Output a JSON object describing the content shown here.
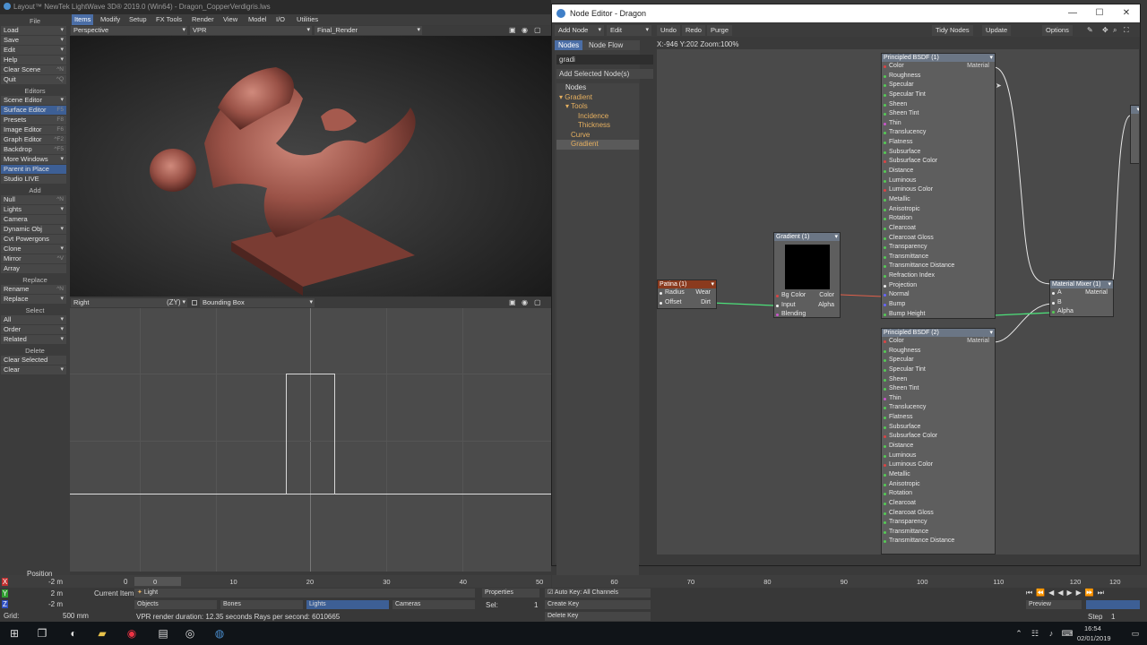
{
  "app": {
    "title": "Layout™ NewTek LightWave 3D® 2019.0 (Win64) - Dragon_CopperVerdigris.lws"
  },
  "left_panel": {
    "file": "File",
    "load": "Load",
    "save": "Save",
    "edit": "Edit",
    "help": "Help",
    "clear_scene": "Clear Scene",
    "clear_scene_key": "^N",
    "quit": "Quit",
    "quit_key": "^Q",
    "editors": "Editors",
    "scene_editor": "Scene Editor",
    "surface_editor": "Surface Editor",
    "surface_editor_key": "F5",
    "presets": "Presets",
    "presets_key": "F8",
    "image_editor": "Image Editor",
    "image_editor_key": "F6",
    "graph_editor": "Graph Editor",
    "graph_editor_key": "^F2",
    "backdrop": "Backdrop",
    "backdrop_key": "^F5",
    "more_windows": "More Windows",
    "parent_in_place": "Parent in Place",
    "studio_live": "Studio LIVE",
    "add": "Add",
    "null": "Null",
    "null_key": "^N",
    "lights": "Lights",
    "camera": "Camera",
    "dynamic_obj": "Dynamic Obj",
    "cvt_powergons": "Cvt Powergons",
    "clone": "Clone",
    "mirror": "Mirror",
    "mirror_key": "^V",
    "array": "Array",
    "replace": "Replace",
    "rename": "Rename",
    "rename_key": "^N",
    "replace_btn": "Replace",
    "select": "Select",
    "all": "All",
    "order": "Order",
    "related": "Related",
    "delete": "Delete",
    "clear_selected": "Clear Selected",
    "clear": "Clear"
  },
  "menu_tabs": [
    "Items",
    "Modify",
    "Setup",
    "FX Tools",
    "Render",
    "View",
    "Model",
    "I/O",
    "Utilities"
  ],
  "viewport_top": {
    "view": "Perspective",
    "mode": "VPR",
    "camera": "Final_Render"
  },
  "viewport_bottom": {
    "view": "Right",
    "axis": "(ZY)",
    "bbox": "Bounding Box"
  },
  "node_editor": {
    "title": "Node Editor - Dragon",
    "toolbar": {
      "add_node": "Add Node",
      "edit": "Edit",
      "undo": "Undo",
      "redo": "Redo",
      "purge": "Purge",
      "tidy": "Tidy Nodes",
      "update": "Update",
      "options": "Options"
    },
    "tabs": {
      "nodes": "Nodes",
      "node_flow": "Node Flow"
    },
    "search": "gradi",
    "add_selected": "Add Selected Node(s)",
    "coords": "X:-946 Y:202 Zoom:100%",
    "tree": [
      "Nodes",
      "Gradient",
      "Tools",
      "Incidence",
      "Thickness",
      "Curve",
      "Gradient"
    ],
    "bsdf1_title": "Principled BSDF (1)",
    "bsdf2_title": "Principled BSDF (2)",
    "material": "Material",
    "bsdf_inputs": [
      "Color",
      "Roughness",
      "Specular",
      "Specular Tint",
      "Sheen",
      "Sheen Tint",
      "Thin",
      "Translucency",
      "Flatness",
      "Subsurface",
      "Subsurface Color",
      "Distance",
      "Luminous",
      "Luminous Color",
      "Metallic",
      "Anisotropic",
      "Rotation",
      "Clearcoat",
      "Clearcoat Gloss",
      "Transparency",
      "Transmittance",
      "Transmittance Distance",
      "Refraction Index",
      "Projection",
      "Normal",
      "Bump",
      "Bump Height"
    ],
    "gradient": {
      "title": "Gradient (1)",
      "inputs": [
        "Bg Color",
        "Input",
        "Blending"
      ],
      "outputs": [
        "Color",
        "Alpha"
      ]
    },
    "patina": {
      "title": "Patina (1)",
      "inputs": [
        "Radius",
        "Offset"
      ],
      "outputs": [
        "Wear",
        "Dirt"
      ]
    },
    "mixer": {
      "title": "Material Mixer (1)",
      "inputs": [
        "A",
        "B",
        "Alpha"
      ],
      "output": "Material"
    }
  },
  "timeline": {
    "ticks": [
      "0",
      "10",
      "20",
      "30",
      "40",
      "50",
      "60",
      "70",
      "80",
      "90",
      "100",
      "110",
      "120"
    ],
    "current": "0",
    "end": "120"
  },
  "bottom": {
    "position": "Position",
    "x": "X",
    "y": "Y",
    "z": "Z",
    "x_val": "-2 m",
    "y_val": "2 m",
    "z_val": "-2 m",
    "grid_label": "Grid:",
    "grid": "500 mm",
    "current_item": "Current Item",
    "item": "Light",
    "objects": "Objects",
    "bones": "Bones",
    "lights": "Lights",
    "cameras": "Cameras",
    "properties": "Properties",
    "sel_label": "Sel:",
    "sel": "1",
    "auto_key": "Auto Key: All Channels",
    "create_key": "Create Key",
    "delete_key": "Delete Key",
    "status": "VPR render duration: 12.35 seconds  Rays per second: 6010665",
    "preview": "Preview",
    "step_label": "Step",
    "step": "1"
  },
  "taskbar": {
    "time": "16:54",
    "date": "02/01/2019"
  },
  "colors": {
    "accent": "#4b6ea6",
    "wire_green": "#4de07a",
    "wire_red": "#e0604a",
    "wire_white": "#e8e8e8"
  }
}
